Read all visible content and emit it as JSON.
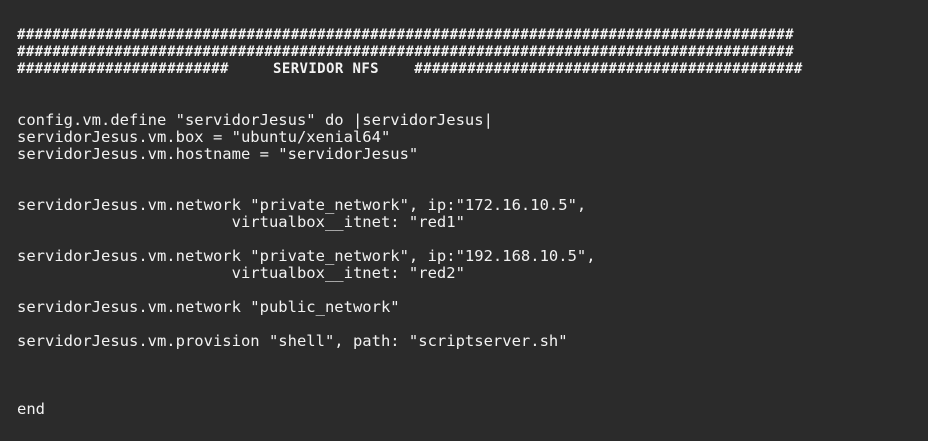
{
  "code": {
    "header": [
      "########################################################################################",
      "########################################################################################",
      "########################     SERVIDOR NFS    ############################################"
    ],
    "lines": [
      "config.vm.define \"servidorJesus\" do |servidorJesus|",
      "servidorJesus.vm.box = \"ubuntu/xenial64\"",
      "servidorJesus.vm.hostname = \"servidorJesus\"",
      "servidorJesus.vm.network \"private_network\", ip:\"172.16.10.5\",",
      "                       virtualbox__itnet: \"red1\"",
      "servidorJesus.vm.network \"private_network\", ip:\"192.168.10.5\",",
      "                       virtualbox__itnet: \"red2\"",
      "servidorJesus.vm.network \"public_network\"",
      "servidorJesus.vm.provision \"shell\", path: \"scriptserver.sh\"",
      "end"
    ]
  }
}
